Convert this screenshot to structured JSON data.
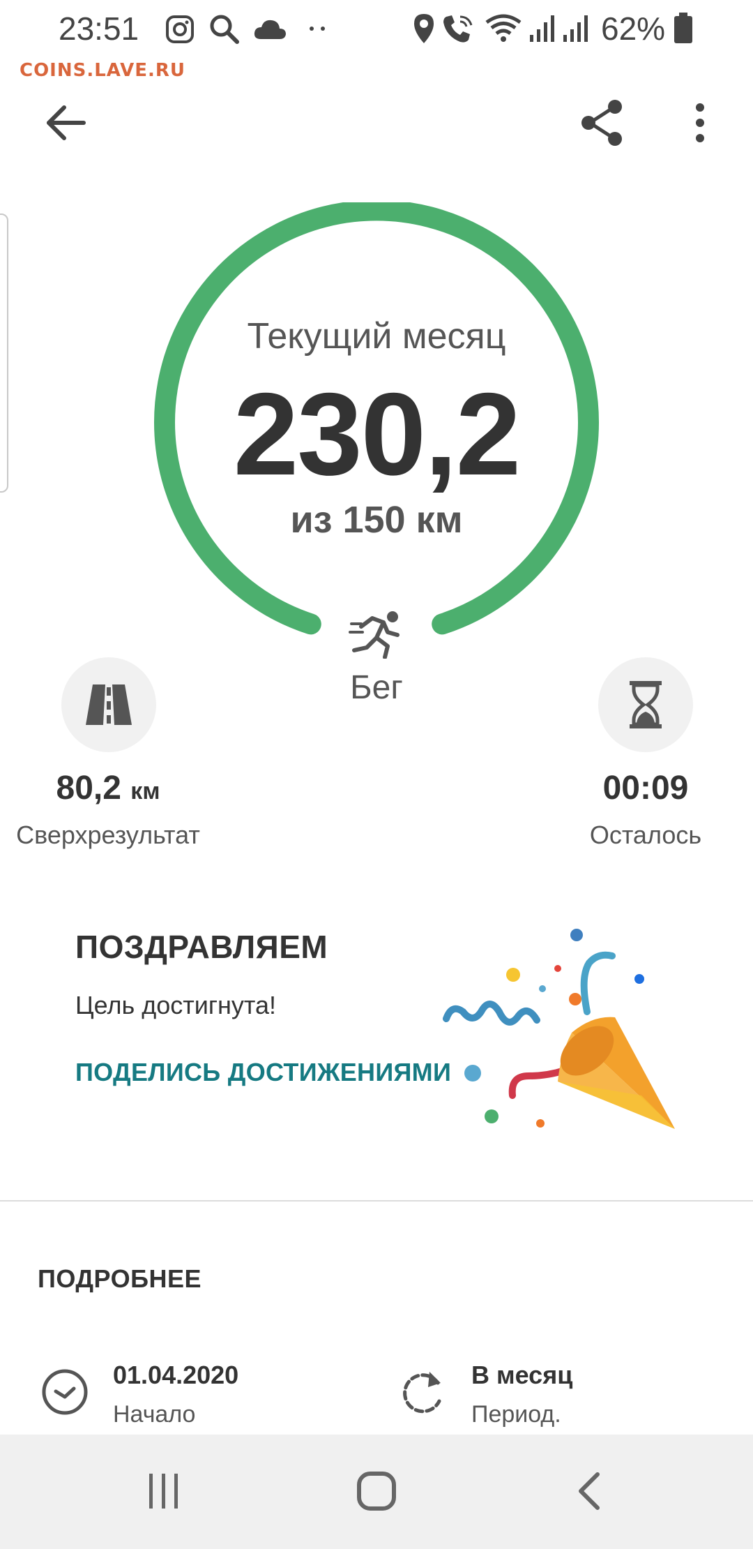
{
  "status_bar": {
    "time": "23:51",
    "battery": "62%",
    "icons": [
      "instagram-icon",
      "search-icon",
      "cloud-icon",
      "more-dots-icon",
      "location-icon",
      "wifi-call-icon",
      "wifi-icon",
      "signal-icon",
      "signal-icon",
      "battery-icon"
    ]
  },
  "watermark": "COINS.LAVE.RU",
  "app_bar": {
    "back_icon": "arrow-left-icon",
    "share_icon": "share-icon",
    "menu_icon": "more-vert-icon"
  },
  "goal": {
    "subtitle": "Текущий месяц",
    "value": "230,2",
    "target": "из 150 км",
    "activity": "Бег",
    "activity_icon": "running-icon",
    "progress_color": "#4caf6e"
  },
  "stats": {
    "extra": {
      "value": "80,2",
      "unit": "км",
      "label": "Сверхрезультат",
      "icon": "road-icon"
    },
    "remaining": {
      "value": "00:09",
      "label": "Осталось",
      "icon": "hourglass-icon"
    }
  },
  "congrats": {
    "title": "ПОЗДРАВЛЯЕМ",
    "text": "Цель достигнута!",
    "share_label": "ПОДЕЛИСЬ ДОСТИЖЕНИЯМИ",
    "share_color": "#167a82",
    "illustration": "party-popper-icon"
  },
  "details": {
    "title": "ПОДРОБНЕЕ",
    "start": {
      "value": "01.04.2020",
      "label": "Начало",
      "icon": "clock-icon"
    },
    "period": {
      "value": "В месяц",
      "label": "Период.",
      "icon": "repeat-icon"
    }
  },
  "navbar": {
    "recent_icon": "recent-apps-icon",
    "home_icon": "home-icon",
    "back_icon": "nav-back-icon"
  }
}
